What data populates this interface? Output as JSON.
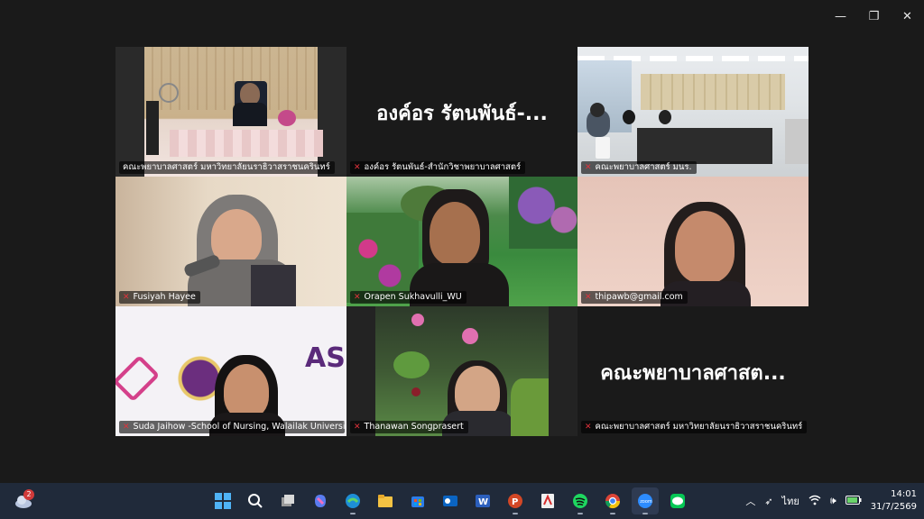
{
  "window_controls": {
    "minimize": "—",
    "restore": "❐",
    "close": "✕"
  },
  "tiles": [
    {
      "name": "คณะพยาบาลศาสตร์ มหาวิทยาลัยนราธิวาสราชนครินทร์",
      "muted": false
    },
    {
      "name": "องค์อร รัตนพันธ์-สำนักวิชาพยาบาลศาสตร์",
      "big_name": "องค์อร รัตนพันธ์-...",
      "muted": true
    },
    {
      "name": "คณะพยาบาลศาสตร์ มนร.",
      "muted": true
    },
    {
      "name": "Fusiyah Hayee",
      "muted": true
    },
    {
      "name": "Orapen Sukhavulli_WU",
      "muted": true
    },
    {
      "name": "thipawb@gmail.com",
      "muted": true
    },
    {
      "name": "Suda Jaihow -School of Nursing, Walailak University",
      "muted": true
    },
    {
      "name": "Thanawan Songprasert",
      "muted": true
    },
    {
      "name": "คณะพยาบาลศาสตร์ มหาวิทยาลัยนราธิวาสราชนครินทร์",
      "big_name": "คณะพยาบาลศาสต...",
      "muted": true
    }
  ],
  "taskbar": {
    "weather_badge": "2",
    "language": "ไทย",
    "time": "14:01",
    "date": "31/7/2569",
    "apps": [
      "start",
      "search",
      "task-view",
      "copilot",
      "edge",
      "file-explorer",
      "microsoft-store",
      "outlook",
      "word",
      "powerpoint",
      "acrobat",
      "spotify",
      "chrome",
      "zoom",
      "line"
    ]
  },
  "colors": {
    "active_speaker": "#3cc86b",
    "muted_mic": "#e0323c",
    "taskbar": "#202a3a"
  }
}
